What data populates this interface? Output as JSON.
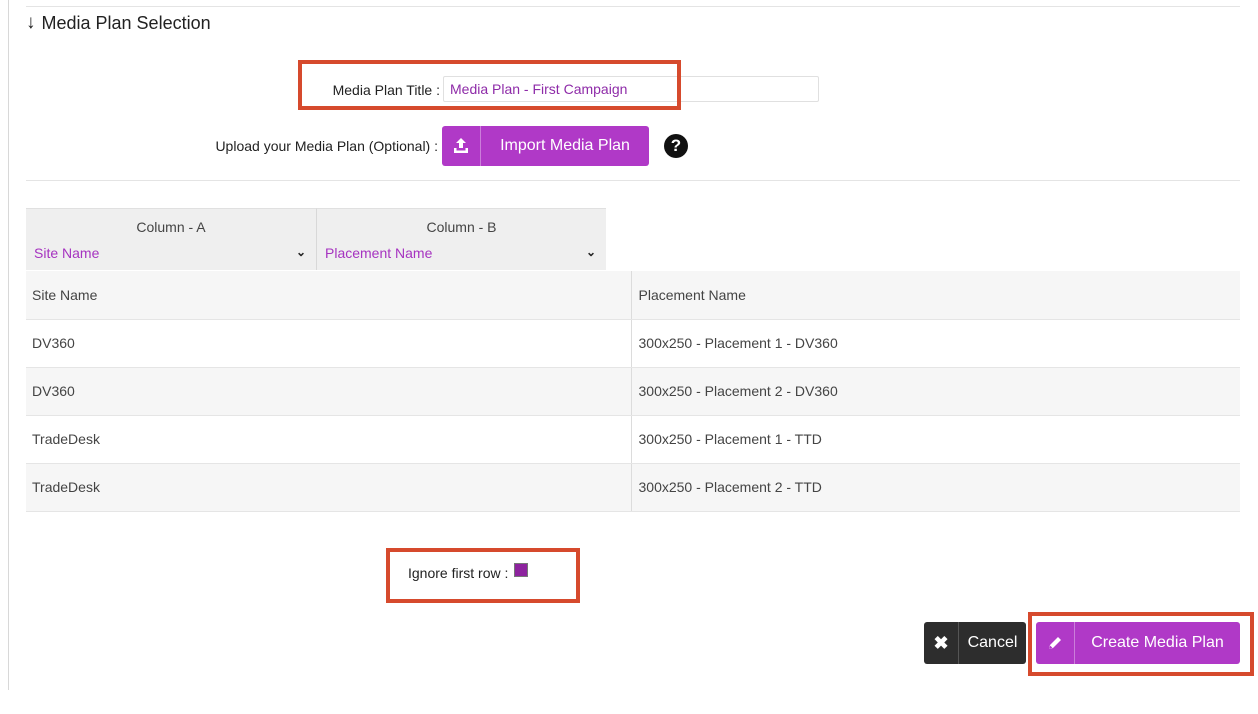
{
  "section": {
    "title": "Media Plan Selection",
    "arrow_icon": "arrow-down-icon"
  },
  "media_plan_title": {
    "label": "Media Plan Title :",
    "value": "Media Plan - First Campaign"
  },
  "upload": {
    "label": "Upload your Media Plan (Optional) :",
    "button_label": "Import Media Plan",
    "button_icon": "upload-icon",
    "help_icon": "question-circle-icon",
    "help_glyph": "?"
  },
  "column_mapping": [
    {
      "title": "Column - A",
      "selected": "Site Name"
    },
    {
      "title": "Column - B",
      "selected": "Placement Name"
    }
  ],
  "rows": [
    [
      "Site Name",
      "Placement Name"
    ],
    [
      "DV360",
      "300x250 - Placement 1 - DV360"
    ],
    [
      "DV360",
      "300x250 - Placement 2 - DV360"
    ],
    [
      "TradeDesk",
      "300x250 - Placement 1 - TTD"
    ],
    [
      "TradeDesk",
      "300x250 - Placement 2 - TTD"
    ]
  ],
  "ignore_first_row": {
    "label": "Ignore first row :",
    "checked": true
  },
  "actions": {
    "cancel_label": "Cancel",
    "cancel_icon": "times-icon",
    "create_label": "Create Media Plan",
    "create_icon": "pencil-icon"
  },
  "colors": {
    "accent": "#b039c7",
    "highlight": "#d64a2d",
    "dark_button": "#2d2d2d",
    "value_text": "#8e2ba8"
  }
}
